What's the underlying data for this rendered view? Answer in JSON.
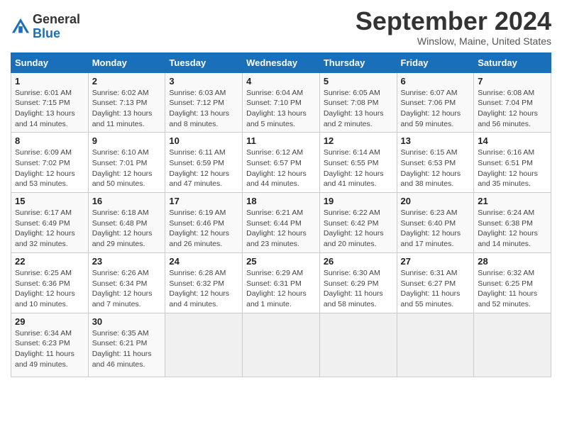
{
  "header": {
    "logo_general": "General",
    "logo_blue": "Blue",
    "month_title": "September 2024",
    "location": "Winslow, Maine, United States"
  },
  "weekdays": [
    "Sunday",
    "Monday",
    "Tuesday",
    "Wednesday",
    "Thursday",
    "Friday",
    "Saturday"
  ],
  "weeks": [
    [
      {
        "day": "1",
        "rise": "6:01 AM",
        "set": "7:15 PM",
        "hours": "13 hours and 14 minutes"
      },
      {
        "day": "2",
        "rise": "6:02 AM",
        "set": "7:13 PM",
        "hours": "13 hours and 11 minutes"
      },
      {
        "day": "3",
        "rise": "6:03 AM",
        "set": "7:12 PM",
        "hours": "13 hours and 8 minutes"
      },
      {
        "day": "4",
        "rise": "6:04 AM",
        "set": "7:10 PM",
        "hours": "13 hours and 5 minutes"
      },
      {
        "day": "5",
        "rise": "6:05 AM",
        "set": "7:08 PM",
        "hours": "13 hours and 2 minutes"
      },
      {
        "day": "6",
        "rise": "6:07 AM",
        "set": "7:06 PM",
        "hours": "12 hours and 59 minutes"
      },
      {
        "day": "7",
        "rise": "6:08 AM",
        "set": "7:04 PM",
        "hours": "12 hours and 56 minutes"
      }
    ],
    [
      {
        "day": "8",
        "rise": "6:09 AM",
        "set": "7:02 PM",
        "hours": "12 hours and 53 minutes"
      },
      {
        "day": "9",
        "rise": "6:10 AM",
        "set": "7:01 PM",
        "hours": "12 hours and 50 minutes"
      },
      {
        "day": "10",
        "rise": "6:11 AM",
        "set": "6:59 PM",
        "hours": "12 hours and 47 minutes"
      },
      {
        "day": "11",
        "rise": "6:12 AM",
        "set": "6:57 PM",
        "hours": "12 hours and 44 minutes"
      },
      {
        "day": "12",
        "rise": "6:14 AM",
        "set": "6:55 PM",
        "hours": "12 hours and 41 minutes"
      },
      {
        "day": "13",
        "rise": "6:15 AM",
        "set": "6:53 PM",
        "hours": "12 hours and 38 minutes"
      },
      {
        "day": "14",
        "rise": "6:16 AM",
        "set": "6:51 PM",
        "hours": "12 hours and 35 minutes"
      }
    ],
    [
      {
        "day": "15",
        "rise": "6:17 AM",
        "set": "6:49 PM",
        "hours": "12 hours and 32 minutes"
      },
      {
        "day": "16",
        "rise": "6:18 AM",
        "set": "6:48 PM",
        "hours": "12 hours and 29 minutes"
      },
      {
        "day": "17",
        "rise": "6:19 AM",
        "set": "6:46 PM",
        "hours": "12 hours and 26 minutes"
      },
      {
        "day": "18",
        "rise": "6:21 AM",
        "set": "6:44 PM",
        "hours": "12 hours and 23 minutes"
      },
      {
        "day": "19",
        "rise": "6:22 AM",
        "set": "6:42 PM",
        "hours": "12 hours and 20 minutes"
      },
      {
        "day": "20",
        "rise": "6:23 AM",
        "set": "6:40 PM",
        "hours": "12 hours and 17 minutes"
      },
      {
        "day": "21",
        "rise": "6:24 AM",
        "set": "6:38 PM",
        "hours": "12 hours and 14 minutes"
      }
    ],
    [
      {
        "day": "22",
        "rise": "6:25 AM",
        "set": "6:36 PM",
        "hours": "12 hours and 10 minutes"
      },
      {
        "day": "23",
        "rise": "6:26 AM",
        "set": "6:34 PM",
        "hours": "12 hours and 7 minutes"
      },
      {
        "day": "24",
        "rise": "6:28 AM",
        "set": "6:32 PM",
        "hours": "12 hours and 4 minutes"
      },
      {
        "day": "25",
        "rise": "6:29 AM",
        "set": "6:31 PM",
        "hours": "12 hours and 1 minute"
      },
      {
        "day": "26",
        "rise": "6:30 AM",
        "set": "6:29 PM",
        "hours": "11 hours and 58 minutes"
      },
      {
        "day": "27",
        "rise": "6:31 AM",
        "set": "6:27 PM",
        "hours": "11 hours and 55 minutes"
      },
      {
        "day": "28",
        "rise": "6:32 AM",
        "set": "6:25 PM",
        "hours": "11 hours and 52 minutes"
      }
    ],
    [
      {
        "day": "29",
        "rise": "6:34 AM",
        "set": "6:23 PM",
        "hours": "11 hours and 49 minutes"
      },
      {
        "day": "30",
        "rise": "6:35 AM",
        "set": "6:21 PM",
        "hours": "11 hours and 46 minutes"
      },
      null,
      null,
      null,
      null,
      null
    ]
  ]
}
